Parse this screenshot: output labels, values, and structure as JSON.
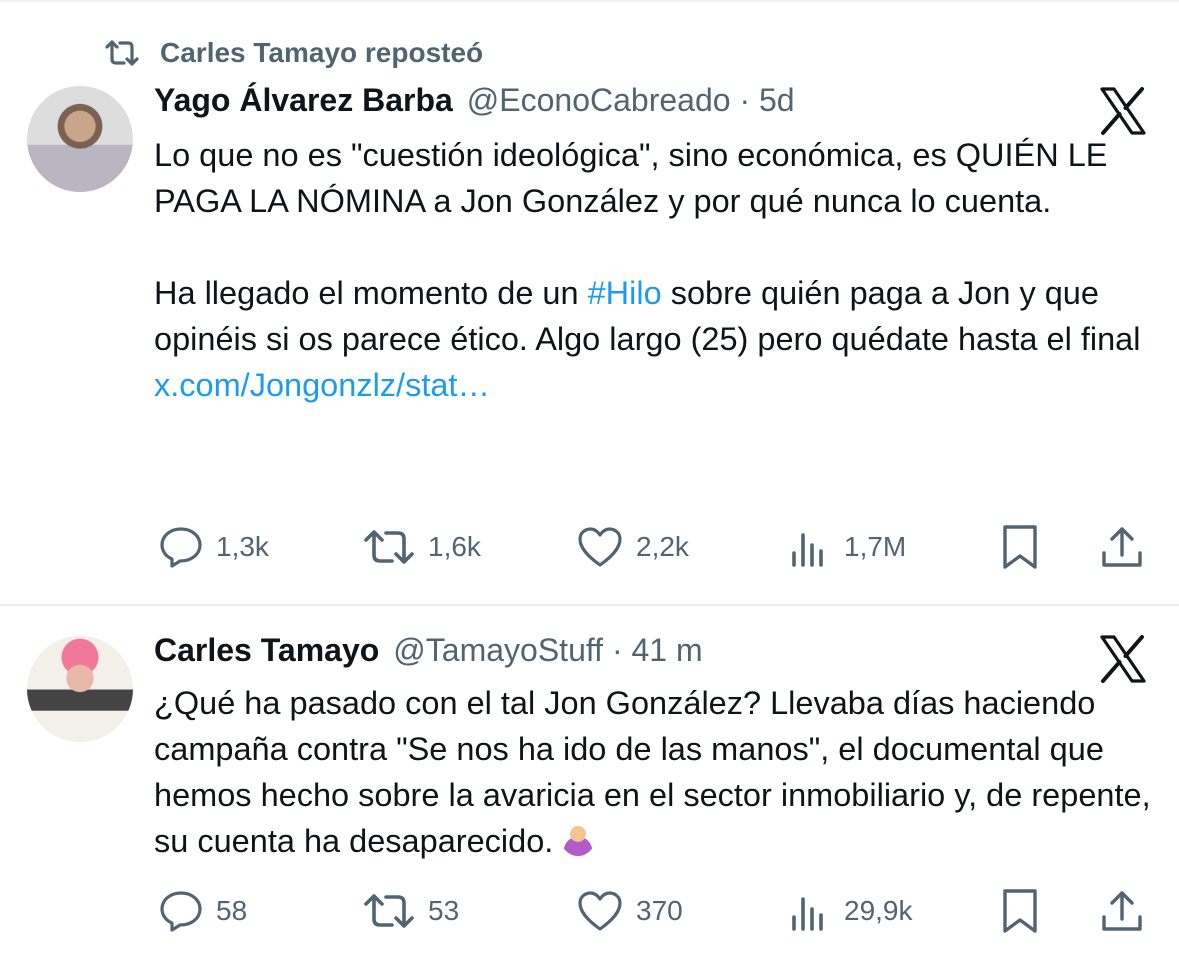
{
  "repost": {
    "text": "Carles Tamayo reposteó"
  },
  "tweets": [
    {
      "author_name": "Yago Álvarez Barba",
      "handle_time": "@EconoCabreado · 5d",
      "paragraph1": "Lo que no es \"cuestión ideológica\", sino económica, es QUIÉN LE PAGA LA NÓMINA a Jon González y por qué nunca lo cuenta.",
      "paragraph2_before": "Ha llegado el momento de un ",
      "hashtag": "#Hilo",
      "paragraph2_after": " sobre quién paga a Jon y que opinéis si os parece ético. Algo largo (25) pero quédate hasta el final",
      "link": "x.com/Jongonzlz/stat…",
      "replies": "1,3k",
      "reposts": "1,6k",
      "likes": "2,2k",
      "views": "1,7M"
    },
    {
      "author_name": "Carles Tamayo",
      "handle_time": "@TamayoStuff · 41 m",
      "text": "¿Qué ha pasado con el tal Jon González? Llevaba días haciendo campaña contra \"Se nos ha ido de las manos\", el documental que hemos hecho sobre la avaricia en el sector inmobiliario y, de repente, su cuenta ha desaparecido.",
      "emoji": "person-shrugging-emoji",
      "replies": "58",
      "reposts": "53",
      "likes": "370",
      "views": "29,9k"
    }
  ],
  "colors": {
    "text": "#0f1419",
    "secondary": "#536471",
    "link": "#1d9bf0",
    "divider": "#e7ecef"
  },
  "icons": [
    "repost-icon",
    "x-logo-icon",
    "reply-icon",
    "like-icon",
    "views-icon",
    "bookmark-icon",
    "share-icon"
  ]
}
